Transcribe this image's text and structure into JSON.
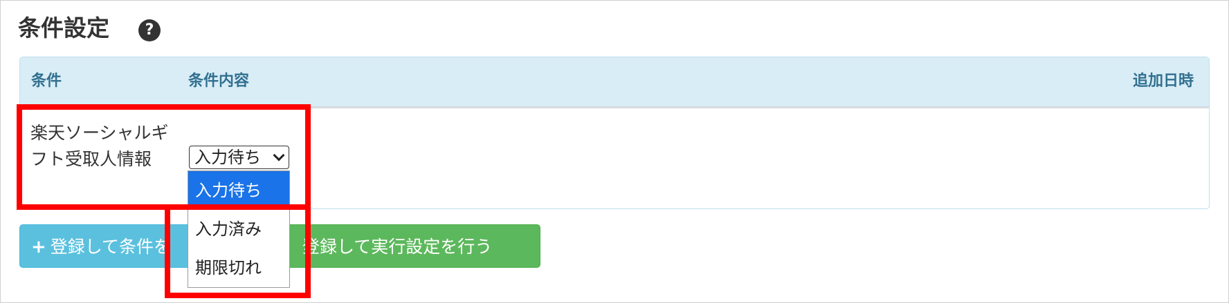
{
  "page": {
    "title": "条件設定",
    "help_icon": "question-circle-icon"
  },
  "table": {
    "headers": {
      "condition": "条件",
      "content": "条件内容",
      "added_at": "追加日時"
    },
    "row": {
      "condition": "楽天ソーシャルギフト受取人情報",
      "select_value": "入力待ち",
      "options": [
        "入力待ち",
        "入力済み",
        "期限切れ"
      ],
      "selected_index": 0
    }
  },
  "buttons": {
    "add_condition": "登録して条件を",
    "register_execute": "登録して実行設定を行う",
    "add_icon": "plus-icon",
    "execute_icon": "chevron-right-icon"
  },
  "colors": {
    "header_bg": "#d9edf7",
    "header_text": "#31708f",
    "btn_info": "#5bc0de",
    "btn_success": "#5cb85c",
    "option_selected": "#1a73e8",
    "highlight": "#ff0000"
  }
}
